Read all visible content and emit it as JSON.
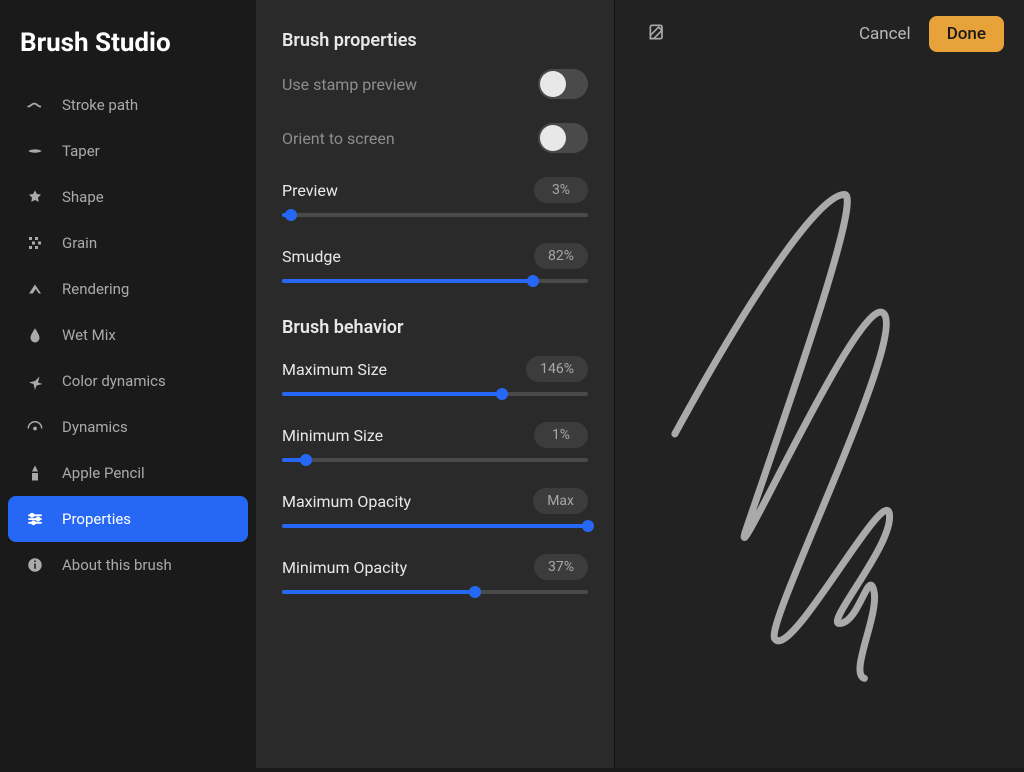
{
  "app_title": "Brush Studio",
  "header": {
    "cancel": "Cancel",
    "done": "Done"
  },
  "sidebar": {
    "items": [
      {
        "label": "Stroke path",
        "icon": "stroke-path-icon"
      },
      {
        "label": "Taper",
        "icon": "taper-icon"
      },
      {
        "label": "Shape",
        "icon": "shape-icon"
      },
      {
        "label": "Grain",
        "icon": "grain-icon"
      },
      {
        "label": "Rendering",
        "icon": "rendering-icon"
      },
      {
        "label": "Wet Mix",
        "icon": "wet-mix-icon"
      },
      {
        "label": "Color dynamics",
        "icon": "color-dynamics-icon"
      },
      {
        "label": "Dynamics",
        "icon": "dynamics-icon"
      },
      {
        "label": "Apple Pencil",
        "icon": "apple-pencil-icon"
      },
      {
        "label": "Properties",
        "icon": "properties-icon",
        "active": true
      },
      {
        "label": "About this brush",
        "icon": "info-icon"
      }
    ]
  },
  "sections": {
    "properties_title": "Brush properties",
    "behavior_title": "Brush behavior",
    "use_stamp_preview": {
      "label": "Use stamp preview",
      "value": false
    },
    "orient_to_screen": {
      "label": "Orient to screen",
      "value": false
    },
    "preview": {
      "label": "Preview",
      "display": "3%",
      "percent": 3
    },
    "smudge": {
      "label": "Smudge",
      "display": "82%",
      "percent": 82
    },
    "max_size": {
      "label": "Maximum Size",
      "display": "146%",
      "percent": 72
    },
    "min_size": {
      "label": "Minimum Size",
      "display": "1%",
      "percent": 8
    },
    "max_opacity": {
      "label": "Maximum Opacity",
      "display": "Max",
      "percent": 100
    },
    "min_opacity": {
      "label": "Minimum Opacity",
      "display": "37%",
      "percent": 63
    }
  },
  "colors": {
    "accent": "#2668f5",
    "done_button": "#e8a23a"
  }
}
